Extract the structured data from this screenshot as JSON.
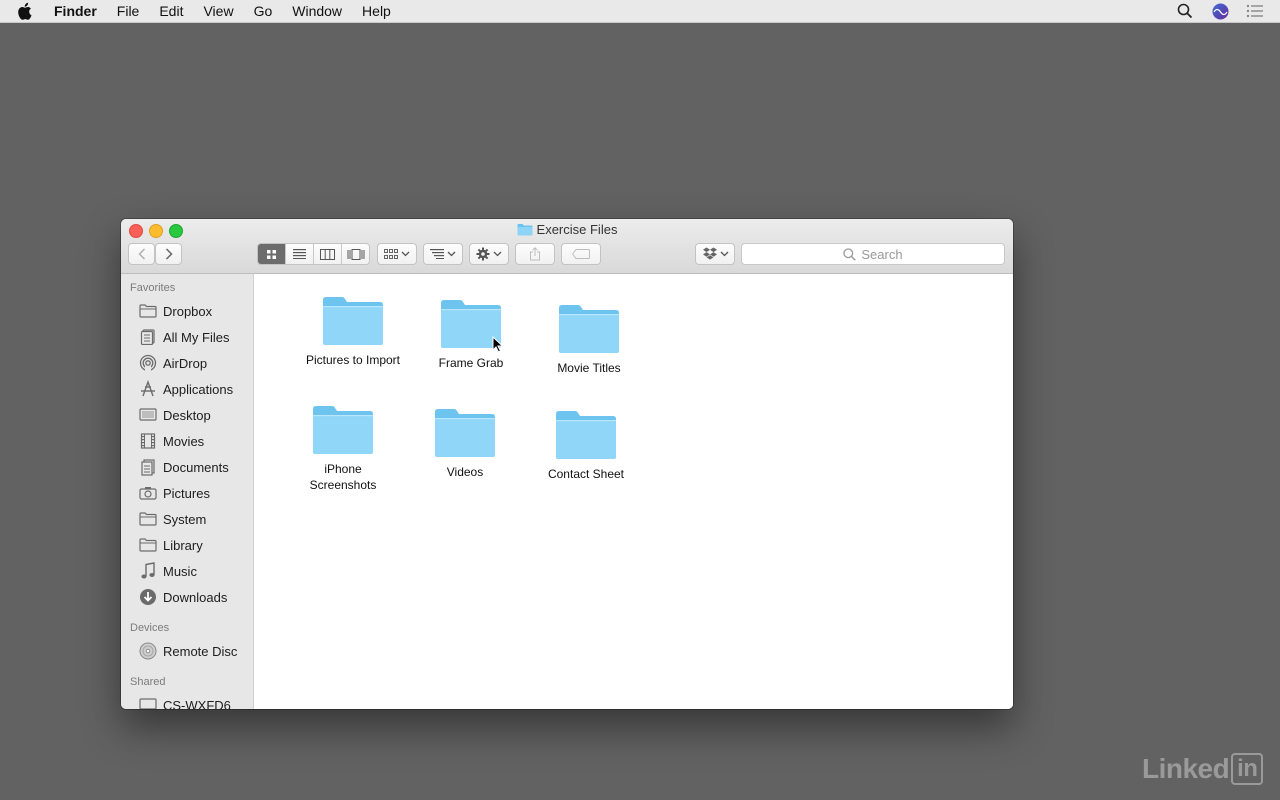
{
  "menubar": {
    "app": "Finder",
    "items": [
      "File",
      "Edit",
      "View",
      "Go",
      "Window",
      "Help"
    ]
  },
  "window": {
    "title": "Exercise Files",
    "search_placeholder": "Search"
  },
  "sidebar": {
    "favorites_heading": "Favorites",
    "favorites": [
      {
        "label": "Dropbox",
        "icon": "folder-icon"
      },
      {
        "label": "All My Files",
        "icon": "all-files-icon"
      },
      {
        "label": "AirDrop",
        "icon": "airdrop-icon"
      },
      {
        "label": "Applications",
        "icon": "applications-icon"
      },
      {
        "label": "Desktop",
        "icon": "desktop-icon"
      },
      {
        "label": "Movies",
        "icon": "film-icon"
      },
      {
        "label": "Documents",
        "icon": "documents-icon"
      },
      {
        "label": "Pictures",
        "icon": "camera-icon"
      },
      {
        "label": "System",
        "icon": "folder-icon"
      },
      {
        "label": "Library",
        "icon": "folder-icon"
      },
      {
        "label": "Music",
        "icon": "music-note-icon"
      },
      {
        "label": "Downloads",
        "icon": "download-icon"
      }
    ],
    "devices_heading": "Devices",
    "devices": [
      {
        "label": "Remote Disc",
        "icon": "disc-icon"
      }
    ],
    "shared_heading": "Shared",
    "shared": [
      {
        "label": "CS-WXFD6",
        "icon": "computer-icon"
      }
    ]
  },
  "content": {
    "folders": [
      {
        "line1": "Pictures to Import",
        "line2": ""
      },
      {
        "line1": "Frame Grab",
        "line2": ""
      },
      {
        "line1": "Movie Titles",
        "line2": ""
      },
      {
        "line1": "iPhone",
        "line2": "Screenshots"
      },
      {
        "line1": "Videos",
        "line2": ""
      },
      {
        "line1": "Contact Sheet",
        "line2": ""
      }
    ]
  },
  "watermark": {
    "text": "Linked",
    "badge": "in"
  },
  "colors": {
    "folder_blue": "#7fd0f5",
    "sidebar_bg": "#e7e7e7",
    "desktop_bg": "#626262"
  }
}
